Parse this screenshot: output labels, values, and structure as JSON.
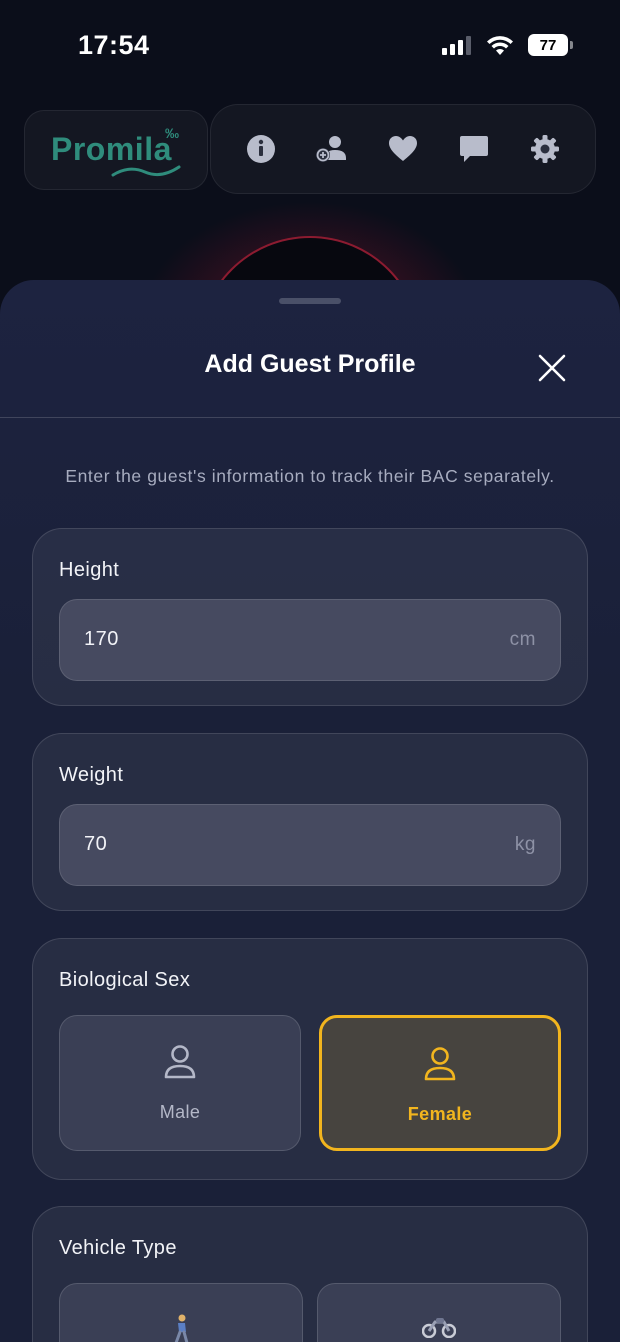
{
  "status_bar": {
    "time": "17:54",
    "battery": "77"
  },
  "logo": {
    "text": "Promila",
    "superscript": "‰"
  },
  "nav": {
    "icons": [
      "info-icon",
      "add-person-icon",
      "heart-icon",
      "chat-icon",
      "gear-icon"
    ]
  },
  "sheet": {
    "title": "Add Guest Profile",
    "intro": "Enter the guest's information to track their BAC separately.",
    "height": {
      "label": "Height",
      "value": "170",
      "unit": "cm"
    },
    "weight": {
      "label": "Weight",
      "value": "70",
      "unit": "kg"
    },
    "sex": {
      "label": "Biological Sex",
      "options": [
        {
          "label": "Male",
          "selected": false
        },
        {
          "label": "Female",
          "selected": true
        }
      ]
    },
    "vehicle": {
      "label": "Vehicle Type",
      "options": [
        {
          "icon": "walking-person-icon"
        },
        {
          "icon": "motorcycle-icon"
        }
      ]
    }
  },
  "colors": {
    "accent": "#f2b51e",
    "brand": "#2f8c7c",
    "glow": "#be1432"
  }
}
